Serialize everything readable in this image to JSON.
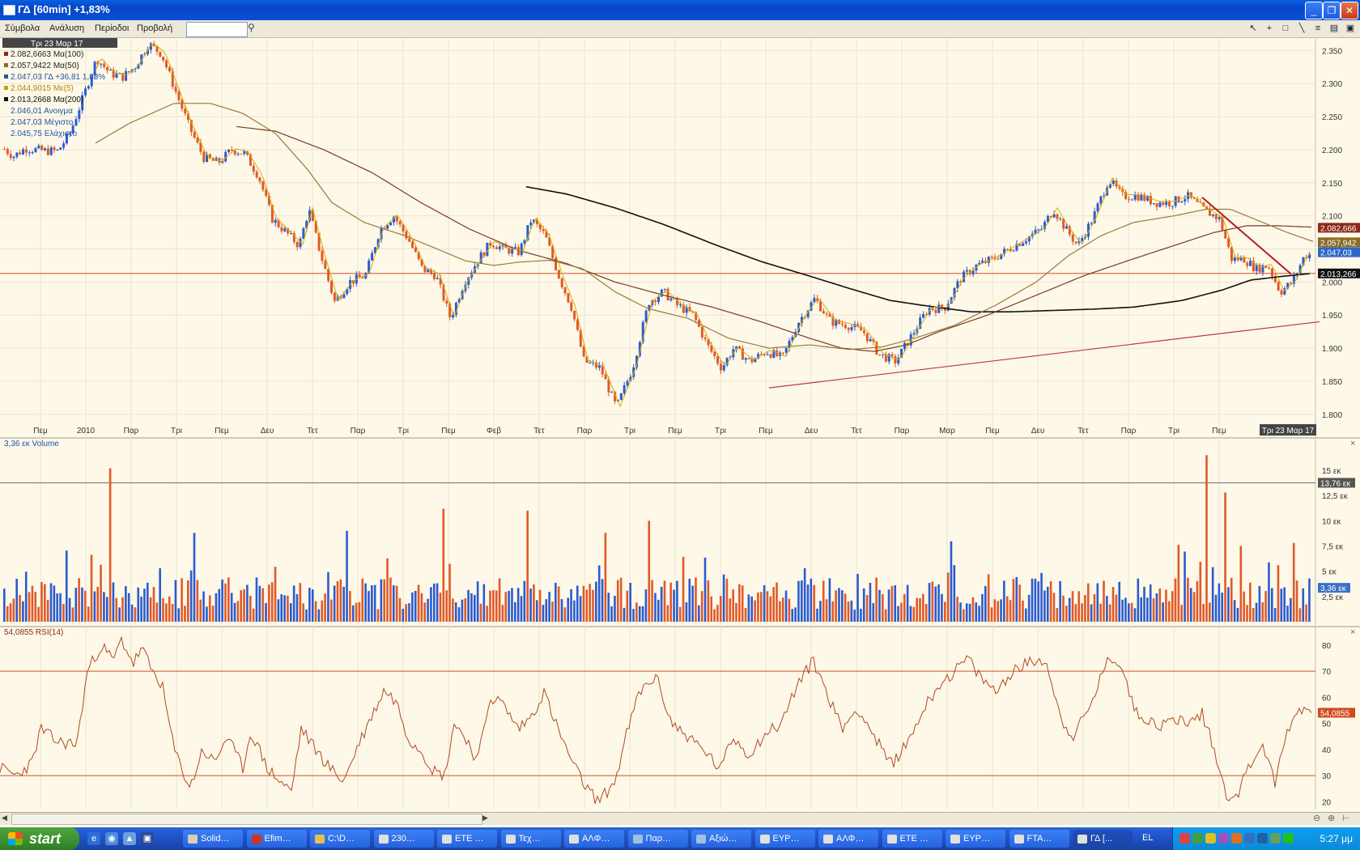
{
  "window": {
    "title": "ΓΔ [60min] +1,83%",
    "buttons": [
      "_",
      "❐",
      "✕"
    ]
  },
  "menu": {
    "items": [
      "Σύμβολα",
      "Ανάλυση",
      "Περίοδοι",
      "Προβολή"
    ],
    "search_value": ""
  },
  "toolbar": {
    "tools": [
      "pointer",
      "crosshair",
      "rectangle",
      "line",
      "list",
      "snapshot",
      "save"
    ]
  },
  "chart_data": [
    {
      "type": "line",
      "title": "",
      "date_header": "Τρι 23 Μαρ 17",
      "legend": [
        {
          "label": "2.082,6663 Μα(100)",
          "color": "#8b2a1a"
        },
        {
          "label": "2.057,9422 Μα(50)",
          "color": "#8b6a2a"
        },
        {
          "label": "2.047,03 ΓΔ +36,81 1,83%",
          "color": "#2255aa"
        },
        {
          "label": "2.044,9015 Με(5)",
          "color": "#c8a000"
        },
        {
          "label": "2.013,2668 Μα(200)",
          "color": "#111111"
        }
      ],
      "ohl": [
        "2.046,01 Ανοιγμα",
        "2.047,03 Μέγιστο",
        "2.045,75 Ελάχιστο"
      ],
      "y_ticks": [
        "2.350",
        "2.300",
        "2.250",
        "2.200",
        "2.150",
        "2.100",
        "2.050",
        "2.000",
        "1.950",
        "1.900",
        "1.850",
        "1.800"
      ],
      "ylim": [
        1790,
        2370
      ],
      "x_ticks": [
        "Πεμ",
        "2010",
        "Παρ",
        "Τρι",
        "Πεμ",
        "Δευ",
        "Τετ",
        "Παρ",
        "Τρι",
        "Πεμ",
        "Φεβ",
        "Τετ",
        "Παρ",
        "Τρι",
        "Πεμ",
        "Τρι",
        "Πεμ",
        "Δευ",
        "Τετ",
        "Παρ",
        "Μαρ",
        "Πεμ",
        "Δευ",
        "Τετ",
        "Παρ",
        "Τρι",
        "Πεμ"
      ],
      "x_current": "Τρι 23 Μαρ 17",
      "price_anchors": [
        [
          0,
          2205
        ],
        [
          15,
          2190
        ],
        [
          30,
          2202
        ],
        [
          55,
          2198
        ],
        [
          70,
          2198
        ],
        [
          85,
          2225
        ],
        [
          100,
          2275
        ],
        [
          118,
          2338
        ],
        [
          135,
          2315
        ],
        [
          150,
          2310
        ],
        [
          165,
          2325
        ],
        [
          182,
          2360
        ],
        [
          198,
          2345
        ],
        [
          215,
          2290
        ],
        [
          232,
          2235
        ],
        [
          250,
          2188
        ],
        [
          268,
          2180
        ],
        [
          285,
          2200
        ],
        [
          300,
          2195
        ],
        [
          318,
          2160
        ],
        [
          335,
          2095
        ],
        [
          352,
          2075
        ],
        [
          368,
          2055
        ],
        [
          380,
          2110
        ],
        [
          395,
          2040
        ],
        [
          412,
          1970
        ],
        [
          430,
          2000
        ],
        [
          450,
          2010
        ],
        [
          468,
          2080
        ],
        [
          485,
          2100
        ],
        [
          505,
          2060
        ],
        [
          520,
          2020
        ],
        [
          537,
          2010
        ],
        [
          555,
          1945
        ],
        [
          572,
          2000
        ],
        [
          590,
          2035
        ],
        [
          605,
          2060
        ],
        [
          620,
          2050
        ],
        [
          640,
          2045
        ],
        [
          655,
          2095
        ],
        [
          672,
          2070
        ],
        [
          690,
          2005
        ],
        [
          705,
          1960
        ],
        [
          720,
          1880
        ],
        [
          740,
          1870
        ],
        [
          760,
          1810
        ],
        [
          780,
          1870
        ],
        [
          800,
          1970
        ],
        [
          818,
          1985
        ],
        [
          835,
          1965
        ],
        [
          855,
          1950
        ],
        [
          872,
          1905
        ],
        [
          890,
          1870
        ],
        [
          905,
          1900
        ],
        [
          925,
          1880
        ],
        [
          945,
          1895
        ],
        [
          965,
          1885
        ],
        [
          985,
          1940
        ],
        [
          1005,
          1975
        ],
        [
          1025,
          1940
        ],
        [
          1045,
          1935
        ],
        [
          1065,
          1925
        ],
        [
          1085,
          1890
        ],
        [
          1105,
          1880
        ],
        [
          1125,
          1920
        ],
        [
          1145,
          1960
        ],
        [
          1165,
          1960
        ],
        [
          1185,
          2005
        ],
        [
          1205,
          2025
        ],
        [
          1225,
          2035
        ],
        [
          1245,
          2050
        ],
        [
          1265,
          2065
        ],
        [
          1285,
          2080
        ],
        [
          1300,
          2110
        ],
        [
          1315,
          2080
        ],
        [
          1330,
          2055
        ],
        [
          1348,
          2095
        ],
        [
          1368,
          2155
        ],
        [
          1385,
          2130
        ],
        [
          1405,
          2130
        ],
        [
          1425,
          2120
        ],
        [
          1445,
          2120
        ],
        [
          1465,
          2130
        ],
        [
          1485,
          2110
        ],
        [
          1505,
          2095
        ],
        [
          1520,
          2035
        ],
        [
          1535,
          2035
        ],
        [
          1550,
          2020
        ],
        [
          1565,
          2025
        ],
        [
          1580,
          1985
        ],
        [
          1595,
          2000
        ],
        [
          1610,
          2040
        ],
        [
          1625,
          2045
        ],
        [
          1645,
          2050
        ]
      ],
      "sma200_anchors": [
        [
          650,
          2144
        ],
        [
          700,
          2133
        ],
        [
          760,
          2112
        ],
        [
          820,
          2087
        ],
        [
          880,
          2058
        ],
        [
          940,
          2031
        ],
        [
          1000,
          2009
        ],
        [
          1050,
          1990
        ],
        [
          1100,
          1972
        ],
        [
          1150,
          1963
        ],
        [
          1200,
          1955
        ],
        [
          1250,
          1955
        ],
        [
          1300,
          1957
        ],
        [
          1350,
          1959
        ],
        [
          1400,
          1962
        ],
        [
          1460,
          1972
        ],
        [
          1510,
          1988
        ],
        [
          1545,
          2003
        ],
        [
          1580,
          2008
        ],
        [
          1620,
          2013
        ]
      ],
      "sma100_anchors": [
        [
          292,
          2235
        ],
        [
          340,
          2228
        ],
        [
          400,
          2200
        ],
        [
          460,
          2165
        ],
        [
          520,
          2120
        ],
        [
          580,
          2080
        ],
        [
          640,
          2048
        ],
        [
          700,
          2028
        ],
        [
          760,
          2000
        ],
        [
          820,
          1980
        ],
        [
          880,
          1962
        ],
        [
          940,
          1940
        ],
        [
          1000,
          1915
        ],
        [
          1040,
          1900
        ],
        [
          1080,
          1895
        ],
        [
          1120,
          1905
        ],
        [
          1160,
          1925
        ],
        [
          1220,
          1950
        ],
        [
          1280,
          1980
        ],
        [
          1340,
          2010
        ],
        [
          1400,
          2035
        ],
        [
          1450,
          2055
        ],
        [
          1500,
          2075
        ],
        [
          1540,
          2085
        ],
        [
          1580,
          2085
        ],
        [
          1620,
          2083
        ]
      ],
      "sma50_anchors": [
        [
          118,
          2210
        ],
        [
          160,
          2240
        ],
        [
          215,
          2270
        ],
        [
          260,
          2270
        ],
        [
          300,
          2255
        ],
        [
          340,
          2225
        ],
        [
          380,
          2170
        ],
        [
          410,
          2120
        ],
        [
          450,
          2090
        ],
        [
          500,
          2070
        ],
        [
          540,
          2050
        ],
        [
          575,
          2032
        ],
        [
          610,
          2025
        ],
        [
          640,
          2030
        ],
        [
          680,
          2033
        ],
        [
          720,
          2020
        ],
        [
          760,
          1985
        ],
        [
          800,
          1960
        ],
        [
          850,
          1945
        ],
        [
          900,
          1915
        ],
        [
          950,
          1900
        ],
        [
          1000,
          1905
        ],
        [
          1050,
          1898
        ],
        [
          1090,
          1902
        ],
        [
          1130,
          1915
        ],
        [
          1180,
          1935
        ],
        [
          1230,
          1965
        ],
        [
          1280,
          2000
        ],
        [
          1320,
          2040
        ],
        [
          1360,
          2070
        ],
        [
          1400,
          2090
        ],
        [
          1450,
          2100
        ],
        [
          1490,
          2110
        ],
        [
          1520,
          2110
        ],
        [
          1550,
          2095
        ],
        [
          1590,
          2075
        ],
        [
          1625,
          2060
        ]
      ],
      "trendlines": [
        {
          "from": [
            950,
            1840
          ],
          "to": [
            1630,
            1940
          ],
          "color": "#c0393b"
        },
        {
          "from": [
            1485,
            2128
          ],
          "to": [
            1595,
            2012
          ],
          "color": "#b02020"
        }
      ],
      "hline": 2013,
      "price_tags": [
        {
          "label": "2.082,666",
          "value": 2082,
          "color": "#8b2a1a"
        },
        {
          "label": "2.057,942",
          "value": 2060,
          "color": "#8b6a2a"
        },
        {
          "label": "2.047,03",
          "value": 2045,
          "color": "#2b67c6"
        },
        {
          "label": "2.013,266",
          "value": 2013,
          "color": "#111111"
        }
      ]
    },
    {
      "type": "bar",
      "title": "3,36 εκ Volume",
      "y_ticks": [
        "15 εκ",
        "12,5 εκ",
        "10 εκ",
        "7,5 εκ",
        "5 εκ",
        "2,5 εκ"
      ],
      "ylim": [
        0,
        17
      ],
      "hline_value": 13.76,
      "hline_label": "13,76 εκ",
      "current_label": "3,36 εκ",
      "current_value": 3.36,
      "spikes": [
        [
          135,
          15.2
        ],
        [
          548,
          11.2
        ],
        [
          650,
          11.0
        ],
        [
          745,
          8.8
        ],
        [
          802,
          10.0
        ],
        [
          1488,
          16.5
        ],
        [
          1512,
          12.8
        ],
        [
          1598,
          7.8
        ],
        [
          428,
          9.0
        ],
        [
          237,
          8.8
        ],
        [
          1530,
          7.5
        ],
        [
          1578,
          5.6
        ]
      ],
      "up_color": "#2b5bd0",
      "down_color": "#e05a28"
    },
    {
      "type": "line",
      "title": "54,0855 RSI(14)",
      "y_ticks": [
        "80",
        "70",
        "60",
        "50",
        "40",
        "30",
        "20"
      ],
      "ylim": [
        17,
        84
      ],
      "levels": [
        70,
        30
      ],
      "current_label": "54,0855",
      "current_value": 54.0855,
      "rsi_anchors": [
        [
          0,
          33
        ],
        [
          20,
          30
        ],
        [
          40,
          35
        ],
        [
          50,
          48
        ],
        [
          70,
          43
        ],
        [
          95,
          42
        ],
        [
          108,
          70
        ],
        [
          125,
          80
        ],
        [
          140,
          74
        ],
        [
          150,
          82
        ],
        [
          165,
          73
        ],
        [
          175,
          79
        ],
        [
          188,
          70
        ],
        [
          200,
          65
        ],
        [
          215,
          40
        ],
        [
          235,
          25
        ],
        [
          250,
          40
        ],
        [
          265,
          35
        ],
        [
          280,
          45
        ],
        [
          300,
          33
        ],
        [
          310,
          47
        ],
        [
          330,
          33
        ],
        [
          345,
          28
        ],
        [
          360,
          24
        ],
        [
          372,
          48
        ],
        [
          390,
          40
        ],
        [
          410,
          32
        ],
        [
          425,
          28
        ],
        [
          440,
          40
        ],
        [
          458,
          52
        ],
        [
          475,
          63
        ],
        [
          490,
          58
        ],
        [
          505,
          44
        ],
        [
          520,
          40
        ],
        [
          535,
          32
        ],
        [
          550,
          30
        ],
        [
          560,
          50
        ],
        [
          575,
          45
        ],
        [
          590,
          35
        ],
        [
          605,
          60
        ],
        [
          620,
          58
        ],
        [
          640,
          48
        ],
        [
          655,
          52
        ],
        [
          672,
          62
        ],
        [
          690,
          47
        ],
        [
          710,
          33
        ],
        [
          725,
          25
        ],
        [
          740,
          20
        ],
        [
          760,
          28
        ],
        [
          775,
          47
        ],
        [
          790,
          62
        ],
        [
          810,
          68
        ],
        [
          830,
          50
        ],
        [
          850,
          45
        ],
        [
          875,
          38
        ],
        [
          890,
          32
        ],
        [
          905,
          45
        ],
        [
          925,
          38
        ],
        [
          945,
          46
        ],
        [
          965,
          50
        ],
        [
          985,
          65
        ],
        [
          1005,
          74
        ],
        [
          1020,
          63
        ],
        [
          1040,
          48
        ],
        [
          1060,
          56
        ],
        [
          1080,
          45
        ],
        [
          1100,
          34
        ],
        [
          1120,
          42
        ],
        [
          1140,
          55
        ],
        [
          1160,
          65
        ],
        [
          1180,
          70
        ],
        [
          1195,
          75
        ],
        [
          1210,
          68
        ],
        [
          1230,
          62
        ],
        [
          1250,
          70
        ],
        [
          1270,
          73
        ],
        [
          1290,
          75
        ],
        [
          1300,
          65
        ],
        [
          1310,
          52
        ],
        [
          1325,
          45
        ],
        [
          1345,
          55
        ],
        [
          1365,
          72
        ],
        [
          1375,
          75
        ],
        [
          1385,
          73
        ],
        [
          1400,
          56
        ],
        [
          1415,
          52
        ],
        [
          1435,
          49
        ],
        [
          1455,
          52
        ],
        [
          1470,
          50
        ],
        [
          1485,
          54
        ],
        [
          1500,
          40
        ],
        [
          1515,
          22
        ],
        [
          1530,
          24
        ],
        [
          1545,
          35
        ],
        [
          1560,
          42
        ],
        [
          1575,
          27
        ],
        [
          1590,
          47
        ],
        [
          1605,
          56
        ],
        [
          1625,
          54
        ]
      ]
    }
  ],
  "scrollbar": {
    "left_arrow": "◀",
    "right_arrow": "▶"
  },
  "taskbar": {
    "start_label": "start",
    "tasks": [
      {
        "label": "Solid…",
        "color": "#d8d0b0"
      },
      {
        "label": "Efim…",
        "color": "#d83020"
      },
      {
        "label": "C:\\D…",
        "color": "#e8c050"
      },
      {
        "label": "230…",
        "color": "#e0e0e0"
      },
      {
        "label": "ETE …",
        "color": "#e0e0e0"
      },
      {
        "label": "Τεχ…",
        "color": "#e0e0e0"
      },
      {
        "label": "ΑΛΦ…",
        "color": "#e0e0e0"
      },
      {
        "label": "Παρ…",
        "color": "#a0c0e0"
      },
      {
        "label": "Αξιώ…",
        "color": "#a0c0e0"
      },
      {
        "label": "ΕΥΡ…",
        "color": "#e0e0e0"
      },
      {
        "label": "ΑΛΦ…",
        "color": "#e0e0e0"
      },
      {
        "label": "ETE …",
        "color": "#e0e0e0"
      },
      {
        "label": "ΕΥΡ…",
        "color": "#e0e0e0"
      },
      {
        "label": "FTA…",
        "color": "#e0e0e0"
      },
      {
        "label": "ΓΔ [...",
        "color": "#e0e0e0"
      }
    ],
    "language": "EL",
    "clock": "5:27 μμ"
  }
}
